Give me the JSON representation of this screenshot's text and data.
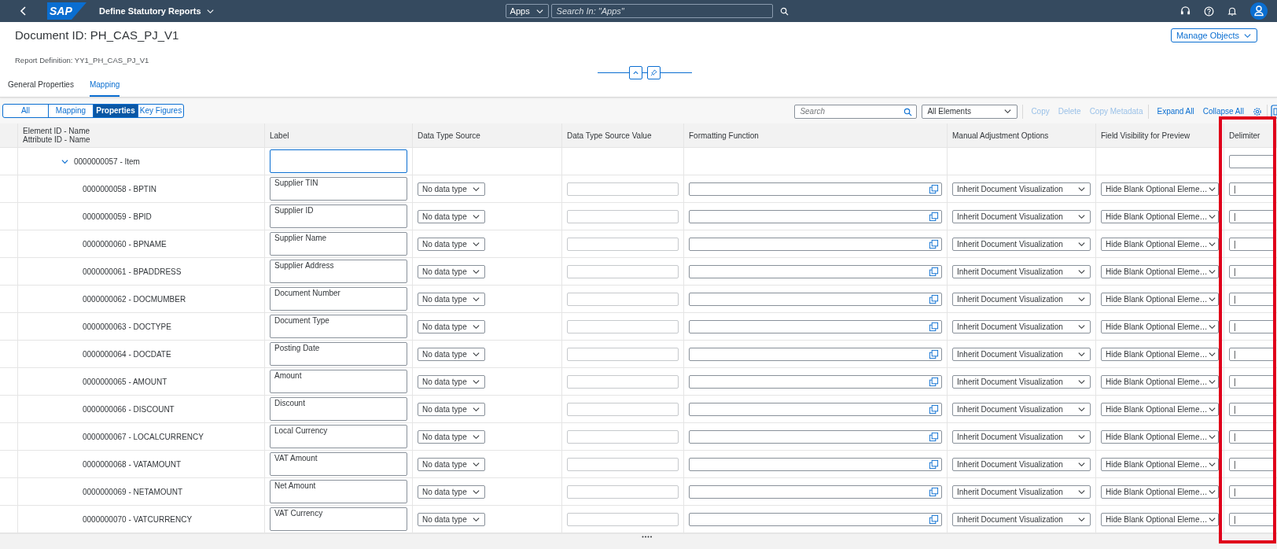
{
  "shell": {
    "logo": "SAP",
    "app_title": "Define Statutory Reports",
    "scope": "Apps",
    "search_placeholder": "Search In: \"Apps\""
  },
  "header": {
    "title": "Document ID: PH_CAS_PJ_V1",
    "action": "Manage Objects",
    "subtitle": "Report Definition: YY1_PH_CAS_PJ_V1"
  },
  "tabs": [
    {
      "label": "General Properties",
      "selected": false
    },
    {
      "label": "Mapping",
      "selected": true
    }
  ],
  "segments": [
    {
      "label": "All",
      "selected": false
    },
    {
      "label": "Mapping",
      "selected": false
    },
    {
      "label": "Properties",
      "selected": true
    },
    {
      "label": "Key Figures",
      "selected": false
    }
  ],
  "toolbar": {
    "search_placeholder": "Search",
    "filter": "All Elements",
    "actions": [
      {
        "label": "Copy",
        "disabled": true
      },
      {
        "label": "Delete",
        "disabled": true
      },
      {
        "label": "Copy Metadata",
        "disabled": true
      },
      {
        "label": "Expand All",
        "disabled": false
      },
      {
        "label": "Collapse All",
        "disabled": false
      }
    ]
  },
  "table": {
    "columns": [
      "Element ID - Name\nAttribute ID - Name",
      "Label",
      "Data Type Source",
      "Data Type Source Value",
      "Formatting Function",
      "Manual Adjustment Options",
      "Field Visibility for Preview",
      "Delimiter"
    ],
    "rows": [
      {
        "element": "0000000057 - Item",
        "expanded": true,
        "focused": true,
        "children": [
          {
            "element": "0000000058 - BPTIN",
            "label": "Supplier TIN",
            "data_type": "No data type",
            "adjustment": "Inherit Document Visualization",
            "visibility": "Hide Blank Optional Eleme…",
            "delimiter": "|"
          },
          {
            "element": "0000000059 - BPID",
            "label": "Supplier ID",
            "data_type": "No data type",
            "adjustment": "Inherit Document Visualization",
            "visibility": "Hide Blank Optional Eleme…",
            "delimiter": "|"
          },
          {
            "element": "0000000060 - BPNAME",
            "label": "Supplier Name",
            "data_type": "No data type",
            "adjustment": "Inherit Document Visualization",
            "visibility": "Hide Blank Optional Eleme…",
            "delimiter": "|"
          },
          {
            "element": "0000000061 - BPADDRESS",
            "label": "Supplier Address",
            "data_type": "No data type",
            "adjustment": "Inherit Document Visualization",
            "visibility": "Hide Blank Optional Eleme…",
            "delimiter": "|"
          },
          {
            "element": "0000000062 - DOCMUMBER",
            "label": "Document Number",
            "data_type": "No data type",
            "adjustment": "Inherit Document Visualization",
            "visibility": "Hide Blank Optional Eleme…",
            "delimiter": "|"
          },
          {
            "element": "0000000063 - DOCTYPE",
            "label": "Document Type",
            "data_type": "No data type",
            "adjustment": "Inherit Document Visualization",
            "visibility": "Hide Blank Optional Eleme…",
            "delimiter": "|"
          },
          {
            "element": "0000000064 - DOCDATE",
            "label": "Posting Date",
            "data_type": "No data type",
            "adjustment": "Inherit Document Visualization",
            "visibility": "Hide Blank Optional Eleme…",
            "delimiter": "|"
          },
          {
            "element": "0000000065 - AMOUNT",
            "label": "Amount",
            "data_type": "No data type",
            "adjustment": "Inherit Document Visualization",
            "visibility": "Hide Blank Optional Eleme…",
            "delimiter": "|"
          },
          {
            "element": "0000000066 - DISCOUNT",
            "label": "Discount",
            "data_type": "No data type",
            "adjustment": "Inherit Document Visualization",
            "visibility": "Hide Blank Optional Eleme…",
            "delimiter": "|"
          },
          {
            "element": "0000000067 - LOCALCURRENCY",
            "label": "Local Currency",
            "data_type": "No data type",
            "adjustment": "Inherit Document Visualization",
            "visibility": "Hide Blank Optional Eleme…",
            "delimiter": "|"
          },
          {
            "element": "0000000068 - VATAMOUNT",
            "label": "VAT Amount",
            "data_type": "No data type",
            "adjustment": "Inherit Document Visualization",
            "visibility": "Hide Blank Optional Eleme…",
            "delimiter": "|"
          },
          {
            "element": "0000000069 - NETAMOUNT",
            "label": "Net Amount",
            "data_type": "No data type",
            "adjustment": "Inherit Document Visualization",
            "visibility": "Hide Blank Optional Eleme…",
            "delimiter": "|"
          },
          {
            "element": "0000000070 - VATCURRENCY",
            "label": "VAT Currency",
            "data_type": "No data type",
            "adjustment": "Inherit Document Visualization",
            "visibility": "Hide Blank Optional Eleme…",
            "delimiter": "|"
          }
        ]
      }
    ]
  }
}
